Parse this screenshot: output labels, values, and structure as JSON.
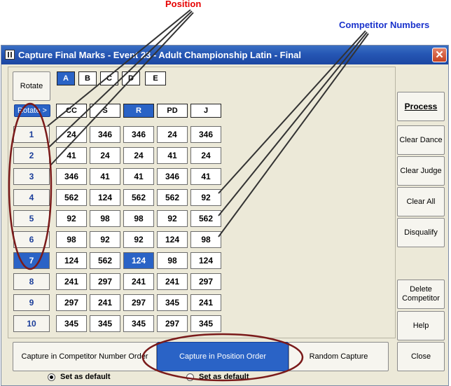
{
  "callouts": {
    "position": "Position",
    "competitor_numbers": "Competitor Numbers"
  },
  "window": {
    "title": "Capture Final Marks - Event 23 - Adult Championship Latin - Final",
    "close_glyph": "✕"
  },
  "left_panel": {
    "rotate_label": "Rotate",
    "rotate_arrow_label": "Rotate >"
  },
  "judges": {
    "tabs": [
      "A",
      "B",
      "C",
      "D",
      "E"
    ],
    "selected": "A"
  },
  "dances": {
    "headers": [
      "CC",
      "S",
      "R",
      "PD",
      "J"
    ],
    "selected": "R"
  },
  "positions": [
    "1",
    "2",
    "3",
    "4",
    "5",
    "6",
    "7",
    "8",
    "9",
    "10"
  ],
  "selected_position": "7",
  "marks": [
    [
      "24",
      "346",
      "346",
      "24",
      "346"
    ],
    [
      "41",
      "24",
      "24",
      "41",
      "24"
    ],
    [
      "346",
      "41",
      "41",
      "346",
      "41"
    ],
    [
      "562",
      "124",
      "562",
      "562",
      "92"
    ],
    [
      "92",
      "98",
      "98",
      "92",
      "562"
    ],
    [
      "98",
      "92",
      "92",
      "124",
      "98"
    ],
    [
      "124",
      "562",
      "124",
      "98",
      "124"
    ],
    [
      "241",
      "297",
      "241",
      "241",
      "297"
    ],
    [
      "297",
      "241",
      "297",
      "345",
      "241"
    ],
    [
      "345",
      "345",
      "345",
      "297",
      "345"
    ]
  ],
  "selected_cell": {
    "row": 6,
    "col": 2
  },
  "sidebar": {
    "process": "Process",
    "clear_dance": "Clear Dance",
    "clear_judge": "Clear Judge",
    "clear_all": "Clear All",
    "disqualify": "Disqualify",
    "delete_competitor": "Delete Competitor",
    "help": "Help",
    "close": "Close"
  },
  "capture_modes": {
    "competitor_order": "Capture in Competitor Number Order",
    "position_order": "Capture in Position Order",
    "random": "Random Capture"
  },
  "defaults": {
    "set_default_left": "Set as default",
    "set_default_right": "Set as default"
  },
  "annotation_colors": {
    "position_text": "#e60000",
    "competitor_text": "#1a33cc",
    "ellipse": "#7a1a1a",
    "lines": "#333333"
  }
}
